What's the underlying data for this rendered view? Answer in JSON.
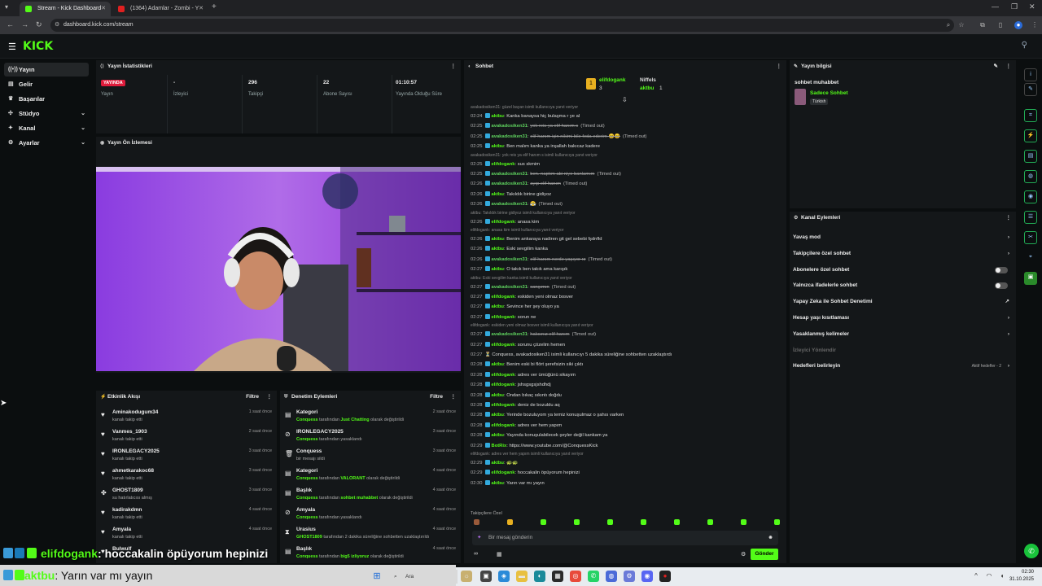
{
  "browser": {
    "tabs": [
      {
        "label": "Stream - Kick Dashboard"
      },
      {
        "label": "(1364) Adamlar - Zombi - Y"
      }
    ],
    "url": "dashboard.kick.com/stream"
  },
  "app": {
    "logo": "KICK"
  },
  "nav": [
    {
      "label": "Yayın",
      "icon": "broadcast-icon"
    },
    {
      "label": "Gelir",
      "icon": "money-icon"
    },
    {
      "label": "Başarılar",
      "icon": "trophy-icon"
    },
    {
      "label": "Stüdyo",
      "icon": "studio-icon"
    },
    {
      "label": "Kanal",
      "icon": "channel-icon"
    },
    {
      "label": "Ayarlar",
      "icon": "gear-icon"
    }
  ],
  "stats": {
    "title": "Yayın İstatistikleri",
    "items": [
      {
        "value": "YAYINDA",
        "label": "Yayın"
      },
      {
        "value": "-",
        "label": "İzleyici"
      },
      {
        "value": "296",
        "label": "Takipçi"
      },
      {
        "value": "22",
        "label": "Abone Sayısı"
      },
      {
        "value": "01:10:57",
        "label": "Yayında Olduğu Süre"
      }
    ]
  },
  "preview": {
    "title": "Yayın Ön İzlemesi"
  },
  "events": {
    "title": "Etkinlik Akışı",
    "filter": "Filtre",
    "items": [
      {
        "name": "Aminakodugum34",
        "desc": "kanalı takip etti",
        "time": "1 saat önce",
        "icon": "heart-icon"
      },
      {
        "name": "Vanmes_1903",
        "desc": "kanalı takip etti",
        "time": "2 saat önce",
        "icon": "heart-icon"
      },
      {
        "name": "IRONLEGACY2025",
        "desc": "kanalı takip etti",
        "time": "3 saat önce",
        "icon": "heart-icon"
      },
      {
        "name": "ahmetkarakoc68",
        "desc": "kanalı takip etti",
        "time": "3 saat önce",
        "icon": "heart-icon"
      },
      {
        "name": "GHOST1809",
        "desc": "su hatırlatıcısı almış",
        "time": "3 saat önce",
        "icon": "gift-icon"
      },
      {
        "name": "kadirakdmn",
        "desc": "kanalı takip etti",
        "time": "4 saat önce",
        "icon": "heart-icon"
      },
      {
        "name": "Amyala",
        "desc": "kanalı takip etti",
        "time": "4 saat önce",
        "icon": "heart-icon"
      },
      {
        "name": "Bulwulf",
        "desc": "",
        "time": "",
        "icon": "heart-icon"
      }
    ]
  },
  "mod": {
    "title": "Denetim Eylemleri",
    "filter": "Filtre",
    "items": [
      {
        "name": "Kategori",
        "by": "Conquess",
        "mid": " tarafından ",
        "obj": "Just Chatting",
        "end": " olarak değiştirildi",
        "time": "2 saat önce",
        "icon": "category-icon"
      },
      {
        "name": "IRONLEGACY2025",
        "by": "Conquess",
        "mid": " tarafından yasaklandı",
        "obj": "",
        "end": "",
        "time": "3 saat önce",
        "icon": "ban-icon"
      },
      {
        "name": "Conquess",
        "by": "",
        "mid": "bir mesajı sildi",
        "obj": "",
        "end": "",
        "time": "3 saat önce",
        "icon": "trash-icon"
      },
      {
        "name": "Kategori",
        "by": "Conquess",
        "mid": " tarafından ",
        "obj": "VALORANT",
        "end": " olarak değiştirildi",
        "time": "4 saat önce",
        "icon": "category-icon"
      },
      {
        "name": "Başlık",
        "by": "Conquess",
        "mid": " tarafından ",
        "obj": "sohbet muhabbet",
        "end": " olarak değiştirildi",
        "time": "4 saat önce",
        "icon": "title-icon"
      },
      {
        "name": "Amyala",
        "by": "Conquess",
        "mid": " tarafından yasaklandı",
        "obj": "",
        "end": "",
        "time": "4 saat önce",
        "icon": "ban-icon"
      },
      {
        "name": "Urasius",
        "by": "GHOST1809",
        "mid": " tarafından 2 dakika süreliğine sohbetten uzaklaştırıldı",
        "obj": "",
        "end": "",
        "time": "4 saat önce",
        "icon": "timeout-icon"
      },
      {
        "name": "Başlık",
        "by": "Conquess",
        "mid": " tarafından ",
        "obj": "big5 izliyoruz",
        "end": " olarak değiştirildi",
        "time": "4 saat önce",
        "icon": "title-icon"
      }
    ]
  },
  "chat": {
    "title": "Sohbet",
    "pinned": {
      "user1": "elifdogank",
      "count1": "3",
      "user2": "Niffels",
      "user3": "aktbu",
      "count3": "1"
    },
    "lines": [
      {
        "type": "reply",
        "text": "avakadosiken31: güzel bayan isimli kullanıcıya yanıt veriyor"
      },
      {
        "ts": "02:24",
        "user": "aktbu",
        "color": "#53fc18",
        "msg": "Kanka banaysa hiç bulaşma r ye al"
      },
      {
        "ts": "02:25",
        "user": "avakadosiken31",
        "color": "#5fd35f",
        "msg": "yok reis ya elif hanım s",
        "struck": true,
        "tmo": "(Timed out)"
      },
      {
        "ts": "02:25",
        "user": "avakadosiken31",
        "color": "#5fd35f",
        "msg": "elif hanım için nikimi bile feda ederim 😊😊",
        "struck": true,
        "tmo": "(Timed out)"
      },
      {
        "ts": "02:25",
        "user": "aktbu",
        "color": "#53fc18",
        "msg": "Ben malım kanka ya inşallah bakıcaz kadere"
      },
      {
        "type": "reply",
        "text": "avakadosiken31: yok reis ya elif hanım s isimli kullanıcıya yanıt veriyor"
      },
      {
        "ts": "02:25",
        "user": "elifdogank",
        "color": "#53fc18",
        "msg": "sus skmim"
      },
      {
        "ts": "02:25",
        "user": "avakadosiken31",
        "color": "#5fd35f",
        "msg": "ben. naptım abi niye banlamım",
        "struck": true,
        "tmo": "(Timed out)"
      },
      {
        "ts": "02:26",
        "user": "avakadosiken31",
        "color": "#5fd35f",
        "msg": "ayıp elif hanım",
        "struck": true,
        "tmo": "(Timed out)"
      },
      {
        "ts": "02:26",
        "user": "aktbu",
        "color": "#53fc18",
        "msg": "Takıldık birine gidiyoz"
      },
      {
        "ts": "02:26",
        "user": "avakadosiken31",
        "color": "#5fd35f",
        "msg": "😤",
        "struck": true,
        "tmo": "(Timed out)"
      },
      {
        "type": "reply",
        "text": "aktbu: Takıldık birine gidiyoz isimli kullanıcıya yanıt veriyor"
      },
      {
        "ts": "02:26",
        "user": "elifdogank",
        "color": "#53fc18",
        "msg": "anasa kim"
      },
      {
        "type": "reply",
        "text": "elifdogank: anasa kim isimli kullanıcıya yanıt veriyor"
      },
      {
        "ts": "02:26",
        "user": "aktbu",
        "color": "#53fc18",
        "msg": "Benim ankaraya nadiren git gel sebebi fşdnfld"
      },
      {
        "ts": "02:26",
        "user": "aktbu",
        "color": "#53fc18",
        "msg": "Eski sevgilim kanka"
      },
      {
        "ts": "02:26",
        "user": "avakadosiken31",
        "color": "#5fd35f",
        "msg": "elif hanım nerde yaşıyor rz",
        "struck": true,
        "tmo": "(Timed out)"
      },
      {
        "ts": "02:27",
        "user": "aktbu",
        "color": "#53fc18",
        "msg": "O takık ben takık ama karışık"
      },
      {
        "type": "reply",
        "text": "aktbu: Eski sevgilim kanka isimli kullanıcıya yanıt veriyor"
      },
      {
        "ts": "02:27",
        "user": "avakadosiken31",
        "color": "#5fd35f",
        "msg": "sanşımın",
        "struck": true,
        "tmo": "(Timed out)"
      },
      {
        "ts": "02:27",
        "user": "elifdogank",
        "color": "#53fc18",
        "msg": "eskiden yeni olmaz bosver"
      },
      {
        "ts": "02:27",
        "user": "aktbu",
        "color": "#53fc18",
        "msg": "Sevince her şey oluyo ya"
      },
      {
        "ts": "02:27",
        "user": "elifdogank",
        "color": "#53fc18",
        "msg": "sorun ne"
      },
      {
        "type": "reply",
        "text": "elifdogank: eskiden yeni olmaz bosver isimli kullanıcıya yanıt veriyor"
      },
      {
        "ts": "02:27",
        "user": "avakadosiken31",
        "color": "#5fd35f",
        "msg": "haksınız elif hanım",
        "struck": true,
        "tmo": "(Timed out)"
      },
      {
        "ts": "02:27",
        "user": "elifdogank",
        "color": "#53fc18",
        "msg": "sorunu çözelim hemen"
      },
      {
        "ts": "02:27",
        "user": "",
        "color": "#ddd",
        "msg": "⏳ Conquess, avakadosiken31 isimli kullanıcıyı 5 dakika süreliğine sohbetten uzaklaştırdı"
      },
      {
        "ts": "02:28",
        "user": "aktbu",
        "color": "#53fc18",
        "msg": "Benim eski bi flört şerefsizin siki çıktı"
      },
      {
        "ts": "02:28",
        "user": "elifdogank",
        "color": "#53fc18",
        "msg": "adres ver ümüğünü sikayım"
      },
      {
        "ts": "02:28",
        "user": "elifdogank",
        "color": "#53fc18",
        "msg": "jshsgsgsjshdhdj"
      },
      {
        "ts": "02:28",
        "user": "aktbu",
        "color": "#53fc18",
        "msg": "Ondan bıkaç sıkıntı doğdu"
      },
      {
        "ts": "02:28",
        "user": "elifdogank",
        "color": "#53fc18",
        "msg": "deniz de bozuldu aq"
      },
      {
        "ts": "02:28",
        "user": "aktbu",
        "color": "#53fc18",
        "msg": "Yerinde bozuluyom ya temiz konuşulmaz o şahıs varken"
      },
      {
        "ts": "02:28",
        "user": "elifdogank",
        "color": "#53fc18",
        "msg": "adres ver hem yapım"
      },
      {
        "ts": "02:28",
        "user": "aktbu",
        "color": "#53fc18",
        "msg": "Yayında konuşulabilecek şeyler değil kankam ya"
      },
      {
        "ts": "02:29",
        "user": "BotRix",
        "color": "#53fc18",
        "msg": "https://www.youtube.com/@ConquessKick"
      },
      {
        "type": "reply",
        "text": "elifdogank: adres ver hem yapım isimli kullanıcıya yanıt veriyor"
      },
      {
        "ts": "02:29",
        "user": "aktbu",
        "color": "#53fc18",
        "msg": "🐢🐢"
      },
      {
        "ts": "02:29",
        "user": "elifdogank",
        "color": "#53fc18",
        "msg": "hoccakalin öpüyorum hepinizi"
      },
      {
        "ts": "02:30",
        "user": "aktbu",
        "color": "#53fc18",
        "msg": "Yarın var mı yayın"
      }
    ],
    "followers_only": "Takipçilere Özel",
    "input_placeholder": "Bir mesaj gönderin",
    "send_label": "Gönder"
  },
  "streaminfo": {
    "title": "Yayın bilgisi",
    "stream_title": "sohbet muhabbet",
    "category": "Sadece Sohbet",
    "language": "Türkish"
  },
  "channel_actions": {
    "title": "Kanal Eylemleri",
    "items": [
      {
        "label": "Yavaş mod",
        "kind": "chevron"
      },
      {
        "label": "Takipçilere özel sohbet",
        "kind": "chevron"
      },
      {
        "label": "Abonelere özel sohbet",
        "kind": "toggle"
      },
      {
        "label": "Yalnızca ifadelerle sohbet",
        "kind": "toggle"
      },
      {
        "label": "Yapay Zeka ile Sohbet Denetimi",
        "kind": "external"
      },
      {
        "label": "Hesap yaşı kısıtlaması",
        "kind": "chevron"
      },
      {
        "label": "Yasaklanmış kelimeler",
        "kind": "chevron"
      },
      {
        "label": "İzleyici Yönlendir",
        "kind": "dim"
      },
      {
        "label": "Hedefleri belirleyin",
        "kind": "chevron",
        "extra": "Aktif hedefler - 2"
      }
    ]
  },
  "overlay": {
    "line1_user": "elifdogank",
    "line1_msg": ": hoccakalin öpüyorum hepinizi",
    "line2_user": "aktbu",
    "line2_msg": ": Yarın var mı yayın"
  },
  "taskbar": {
    "search_label": "Ara",
    "time": "02:30",
    "date": "31.10.2025"
  }
}
